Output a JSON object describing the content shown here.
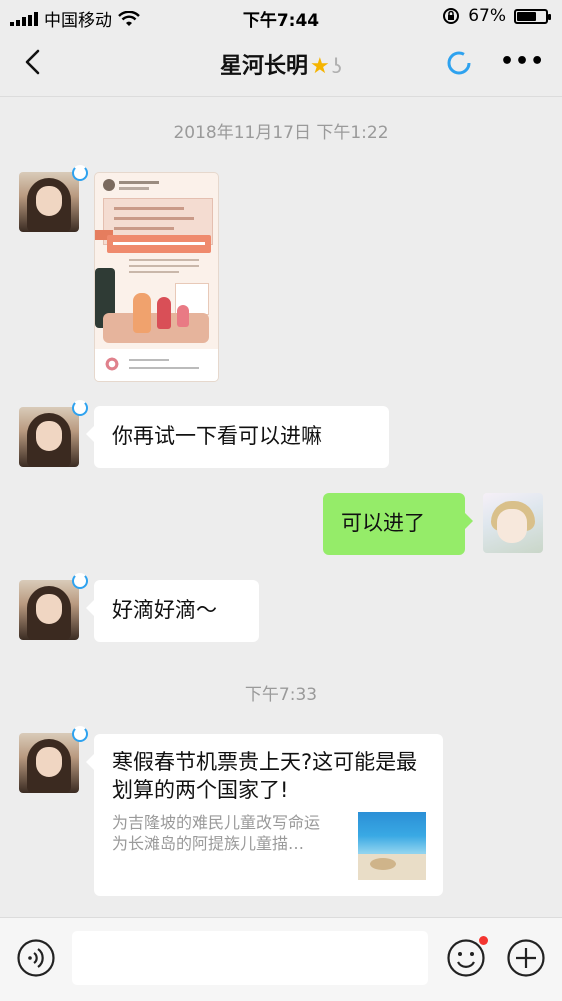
{
  "status_bar": {
    "carrier": "中国移动",
    "time": "下午7:44",
    "battery": "67%",
    "battery_level": 0.67,
    "icons": [
      "signal-icon",
      "wifi-icon",
      "rotation-lock-icon",
      "battery-icon"
    ]
  },
  "nav": {
    "title": "星河长明",
    "title_icons": [
      "star-icon",
      "ear-icon"
    ],
    "icons": [
      "back-icon",
      "loading-ring-icon",
      "more-icon"
    ]
  },
  "chat": {
    "time_1": "2018年11月17日 下午1:22",
    "time_2": "下午7:33",
    "messages": [
      {
        "from": "other",
        "type": "image",
        "icon": "poster-image"
      },
      {
        "from": "other",
        "type": "text",
        "text": "你再试一下看可以进嘛"
      },
      {
        "from": "me",
        "type": "text",
        "text": "可以进了"
      },
      {
        "from": "other",
        "type": "text",
        "text": "好滴好滴～"
      },
      {
        "from": "other",
        "type": "link",
        "title": "寒假春节机票贵上天?这可能是最划算的两个国家了!",
        "desc": "为吉隆坡的难民儿童改写命运\n为长滩岛的阿提族儿童描…",
        "icon": "beach-thumbnail"
      }
    ]
  },
  "input_bar": {
    "value": "",
    "icons": [
      "voice-icon",
      "emoji-icon",
      "plus-icon"
    ],
    "colors": {
      "notify_dot": "#f43530"
    }
  },
  "colors": {
    "background": "#ededed",
    "my_bubble": "#95ec69",
    "other_bubble": "#ffffff",
    "timestamp": "#9a9a9a",
    "accent_blue": "#2ea2ef"
  }
}
